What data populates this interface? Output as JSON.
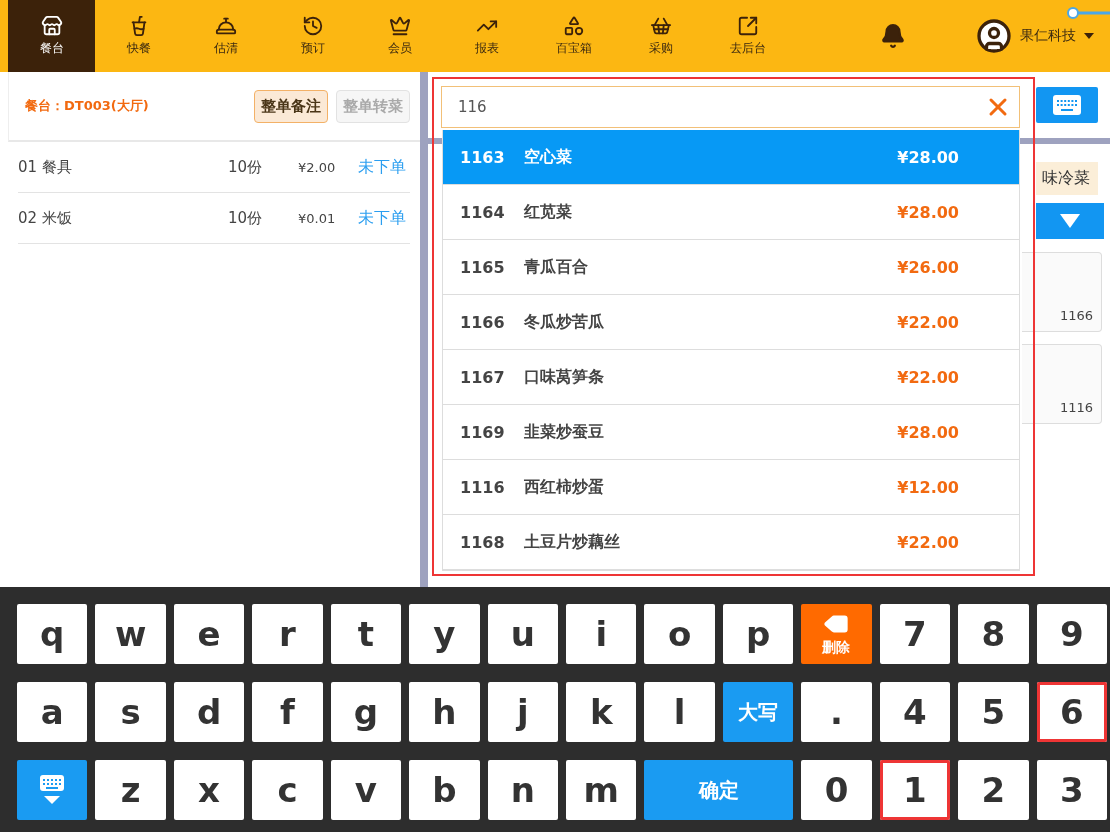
{
  "nav": [
    {
      "label": "餐台",
      "selected": true
    },
    {
      "label": "快餐",
      "selected": false
    },
    {
      "label": "估清",
      "selected": false
    },
    {
      "label": "预订",
      "selected": false
    },
    {
      "label": "会员",
      "selected": false
    },
    {
      "label": "报表",
      "selected": false
    },
    {
      "label": "百宝箱",
      "selected": false
    },
    {
      "label": "采购",
      "selected": false
    },
    {
      "label": "去后台",
      "selected": false
    }
  ],
  "user": {
    "name": "果仁科技"
  },
  "order": {
    "table_label": "餐台：",
    "table": "DT003(大厅)",
    "buttons": [
      {
        "label": "整单备注",
        "disabled": false
      },
      {
        "label": "整单转菜",
        "disabled": true
      }
    ],
    "items": [
      {
        "name": "01 餐具",
        "qty": "10份",
        "price": "¥2.00",
        "status": "未下单"
      },
      {
        "name": "02 米饭",
        "qty": "10份",
        "price": "¥0.01",
        "status": "未下单"
      }
    ]
  },
  "search": {
    "value": "116",
    "highlighted": true
  },
  "category": {
    "label": "味冷菜"
  },
  "dish_cards": [
    {
      "code": "1166"
    },
    {
      "code": "1116"
    }
  ],
  "suggestions": [
    {
      "code": "1163",
      "name": "空心菜",
      "price": "¥28.00",
      "selected": true
    },
    {
      "code": "1164",
      "name": "红苋菜",
      "price": "¥28.00",
      "selected": false
    },
    {
      "code": "1165",
      "name": "青瓜百合",
      "price": "¥26.00",
      "selected": false
    },
    {
      "code": "1166",
      "name": "冬瓜炒苦瓜",
      "price": "¥22.00",
      "selected": false
    },
    {
      "code": "1167",
      "name": "口味莴笋条",
      "price": "¥22.00",
      "selected": false
    },
    {
      "code": "1169",
      "name": "韭菜炒蚕豆",
      "price": "¥28.00",
      "selected": false
    },
    {
      "code": "1116",
      "name": "西红柿炒蛋",
      "price": "¥12.00",
      "selected": false
    },
    {
      "code": "1168",
      "name": "土豆片炒藕丝",
      "price": "¥22.00",
      "selected": false
    }
  ],
  "keyboard": [
    {
      "kind": "char",
      "label": "q",
      "highlighted": false
    },
    {
      "kind": "char",
      "label": "w",
      "highlighted": false
    },
    {
      "kind": "char",
      "label": "e",
      "highlighted": false
    },
    {
      "kind": "char",
      "label": "r",
      "highlighted": false
    },
    {
      "kind": "char",
      "label": "t",
      "highlighted": false
    },
    {
      "kind": "char",
      "label": "y",
      "highlighted": false
    },
    {
      "kind": "char",
      "label": "u",
      "highlighted": false
    },
    {
      "kind": "char",
      "label": "i",
      "highlighted": false
    },
    {
      "kind": "char",
      "label": "o",
      "highlighted": false
    },
    {
      "kind": "char",
      "label": "p",
      "highlighted": false
    },
    {
      "kind": "delete",
      "label": "删除",
      "highlighted": false
    },
    {
      "kind": "char",
      "label": "7",
      "highlighted": false
    },
    {
      "kind": "char",
      "label": "8",
      "highlighted": false
    },
    {
      "kind": "char",
      "label": "9",
      "highlighted": false
    },
    {
      "kind": "char",
      "label": "a",
      "highlighted": false
    },
    {
      "kind": "char",
      "label": "s",
      "highlighted": false
    },
    {
      "kind": "char",
      "label": "d",
      "highlighted": false
    },
    {
      "kind": "char",
      "label": "f",
      "highlighted": false
    },
    {
      "kind": "char",
      "label": "g",
      "highlighted": false
    },
    {
      "kind": "char",
      "label": "h",
      "highlighted": false
    },
    {
      "kind": "char",
      "label": "j",
      "highlighted": false
    },
    {
      "kind": "char",
      "label": "k",
      "highlighted": false
    },
    {
      "kind": "char",
      "label": "l",
      "highlighted": false
    },
    {
      "kind": "caps",
      "label": "大写",
      "highlighted": false
    },
    {
      "kind": "char",
      "label": ".",
      "highlighted": false
    },
    {
      "kind": "char",
      "label": "4",
      "highlighted": false
    },
    {
      "kind": "char",
      "label": "5",
      "highlighted": false
    },
    {
      "kind": "char",
      "label": "6",
      "highlighted": true
    },
    {
      "kind": "hide",
      "highlighted": false
    },
    {
      "kind": "char",
      "label": "z",
      "highlighted": false
    },
    {
      "kind": "char",
      "label": "x",
      "highlighted": false
    },
    {
      "kind": "char",
      "label": "c",
      "highlighted": false
    },
    {
      "kind": "char",
      "label": "v",
      "highlighted": false
    },
    {
      "kind": "char",
      "label": "b",
      "highlighted": false
    },
    {
      "kind": "char",
      "label": "n",
      "highlighted": false
    },
    {
      "kind": "char",
      "label": "m",
      "highlighted": false
    },
    {
      "kind": "confirm",
      "label": "确定",
      "highlighted": false
    },
    {
      "kind": "char",
      "label": "0",
      "highlighted": false
    },
    {
      "kind": "char",
      "label": "1",
      "highlighted": true
    },
    {
      "kind": "char",
      "label": "2",
      "highlighted": false
    },
    {
      "kind": "char",
      "label": "3",
      "highlighted": false
    }
  ]
}
